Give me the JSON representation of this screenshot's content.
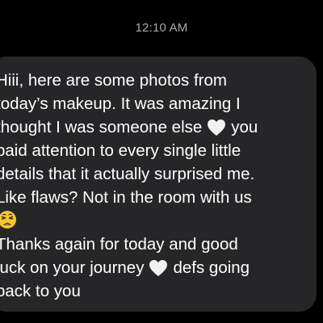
{
  "status": {
    "timestamp": "12:10 AM"
  },
  "message": {
    "lines": {
      "l1": "Hiii, here are some photos from",
      "l2": "today’s makeup. It was amazing I",
      "l3a": "thought I was someone else",
      "l3b": "you",
      "l4": "paid attention to every single little",
      "l5": "details that it actually surprised me.",
      "l6": "Like flaws? Not in the room with us",
      "l8": "Thanks again for today and good",
      "l9a": "luck on your journey",
      "l9b": "defs going",
      "l10": "back to you"
    },
    "emoji": {
      "heart_1": "white-heart-icon",
      "face": "weary-face-icon",
      "heart_2": "white-heart-icon"
    },
    "colors": {
      "bubble": "#262628",
      "text": "#ffffff",
      "timestamp": "#a8a8ad",
      "background": "#000000",
      "emoji_face": "#f7c531"
    }
  }
}
